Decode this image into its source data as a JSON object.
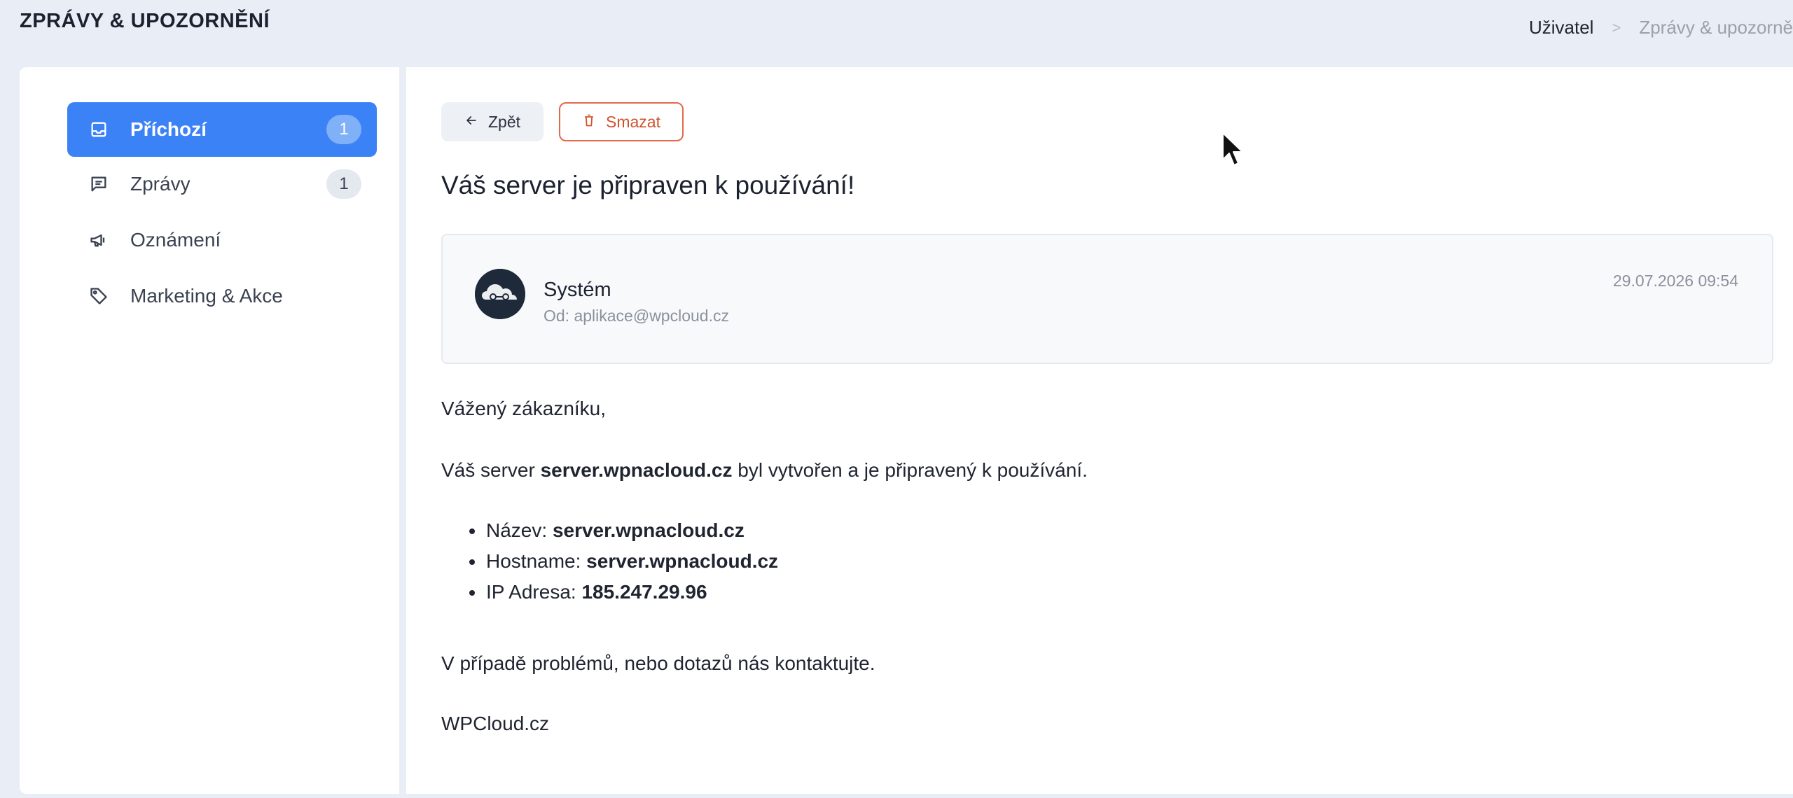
{
  "header": {
    "title": "ZPRÁVY & UPOZORNĚNÍ",
    "breadcrumb": {
      "user": "Uživatel",
      "separator": ">",
      "current": "Zprávy & upozorně"
    }
  },
  "sidebar": {
    "items": [
      {
        "label": "Příchozí",
        "icon": "inbox-icon",
        "badge": "1",
        "active": true
      },
      {
        "label": "Zprávy",
        "icon": "message-icon",
        "badge": "1",
        "active": false
      },
      {
        "label": "Oznámení",
        "icon": "megaphone-icon",
        "badge": null,
        "active": false
      },
      {
        "label": "Marketing & Akce",
        "icon": "tag-icon",
        "badge": null,
        "active": false
      }
    ]
  },
  "toolbar": {
    "back_label": "Zpět",
    "delete_label": "Smazat"
  },
  "message": {
    "title": "Váš server je připraven k používání!",
    "sender": {
      "name": "Systém",
      "from": "Od: aplikace@wpcloud.cz",
      "date": "29.07.2026 09:54"
    },
    "body": {
      "greeting": "Vážený zákazníku,",
      "intro_prefix": "Váš server ",
      "intro_server": "server.wpnacloud.cz",
      "intro_suffix": " byl vytvořen a je připravený k používání.",
      "details": [
        {
          "label": "Název: ",
          "value": "server.wpnacloud.cz"
        },
        {
          "label": "Hostname: ",
          "value": "server.wpnacloud.cz"
        },
        {
          "label": "IP Adresa: ",
          "value": "185.247.29.96"
        }
      ],
      "contact": "V případě problémů, nebo dotazů nás kontaktujte.",
      "signature": "WPCloud.cz"
    }
  },
  "colors": {
    "background": "#e9edf5",
    "accent": "#3b82f6",
    "danger": "#d0532f"
  }
}
